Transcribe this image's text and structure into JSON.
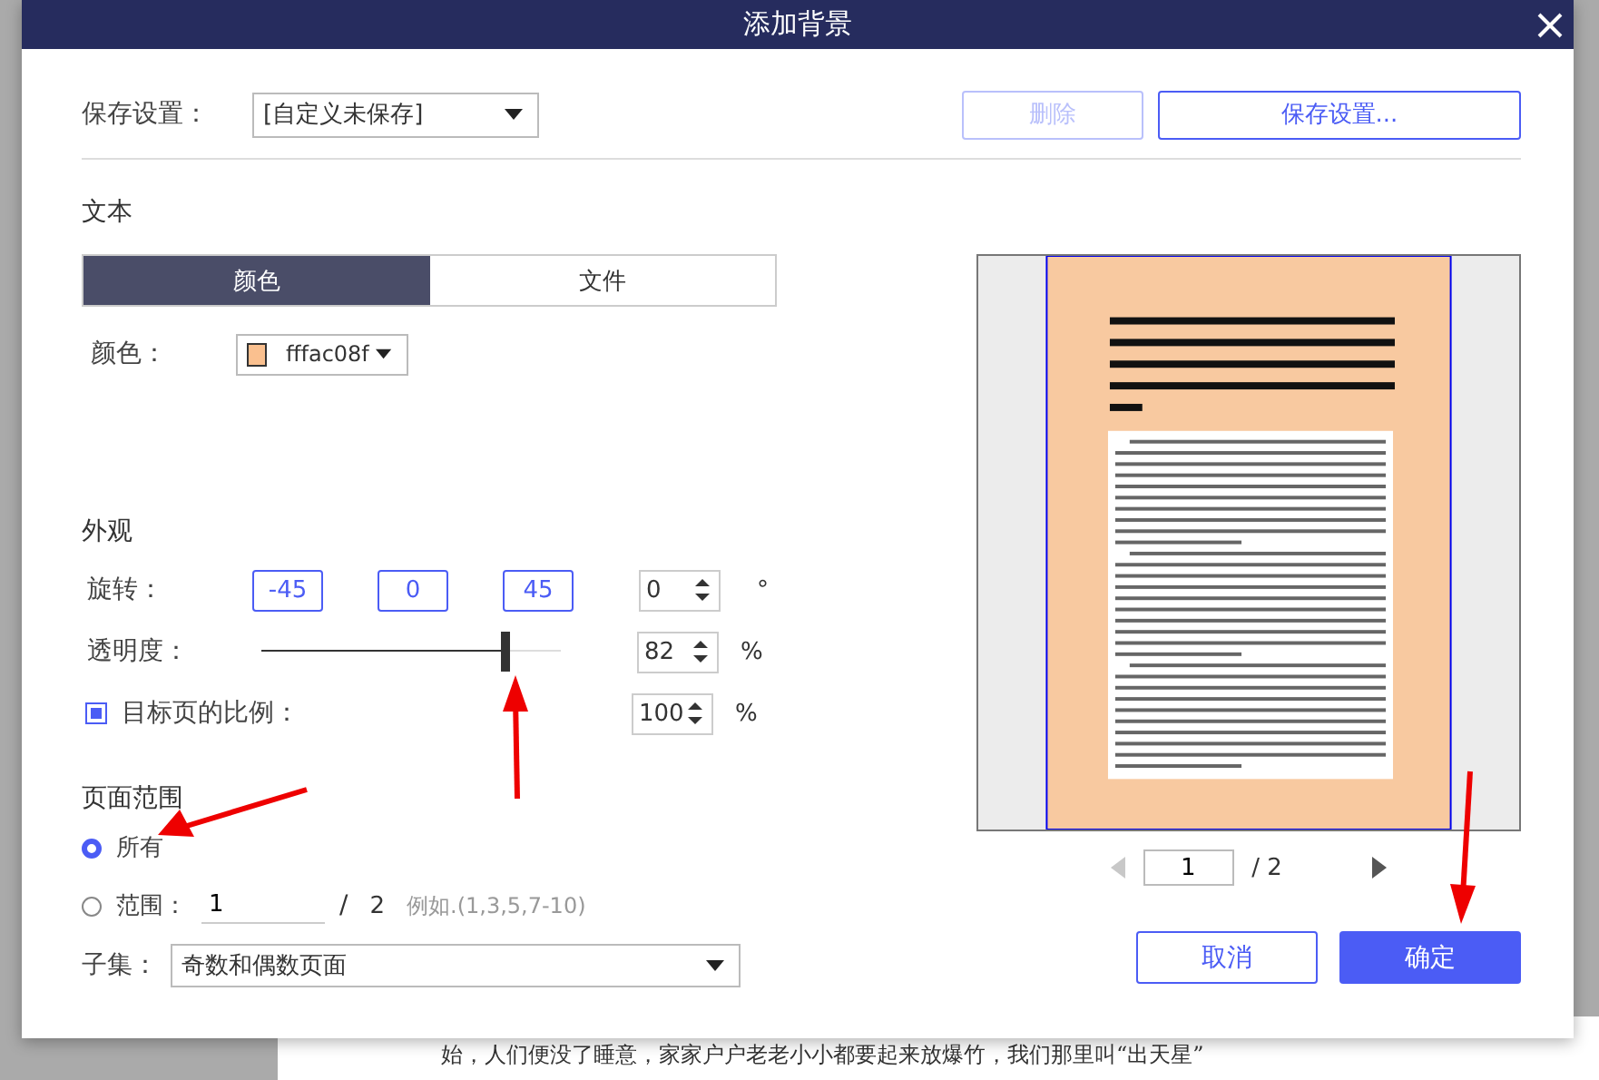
{
  "window": {
    "title": "添加背景"
  },
  "preset": {
    "label": "保存设置：",
    "value": "[自定义未保存]",
    "buttons": [
      {
        "label": "删除",
        "disabled": true
      },
      {
        "label": "保存设置...",
        "disabled": false
      }
    ]
  },
  "text_section": {
    "heading": "文本",
    "tabs": [
      {
        "label": "颜色",
        "selected": true
      },
      {
        "label": "文件",
        "selected": false
      }
    ],
    "color_label": "颜色：",
    "color_value": "fffac08f"
  },
  "appearance": {
    "heading": "外观",
    "rotation": {
      "label": "旋转：",
      "presets": [
        "-45",
        "0",
        "45"
      ],
      "value": "0",
      "unit": "°"
    },
    "opacity": {
      "label": "透明度：",
      "level": 0.82,
      "value": "82",
      "unit": "%"
    },
    "scale": {
      "label": "目标页的比例：",
      "checked": true,
      "value": "100",
      "unit": "%"
    }
  },
  "page_range": {
    "heading": "页面范围",
    "options": [
      {
        "label": "所有",
        "selected": true
      },
      {
        "label": "范围：",
        "selected": false
      }
    ],
    "range_value": "1",
    "range_separator": "/",
    "range_total": "2",
    "range_hint": "例如.(1,3,5,7-10)",
    "subset_label": "子集：",
    "subset_value": "奇数和偶数页面"
  },
  "preview": {
    "page": "1",
    "total": "/ 2"
  },
  "buttons": [
    {
      "label": "取消",
      "kind": "secondary"
    },
    {
      "label": "确定",
      "kind": "primary"
    }
  ],
  "background_text": "始，人们便没了睡意，家家户户老老小小都要起来放爆竹，我们那里叫“出天星”"
}
